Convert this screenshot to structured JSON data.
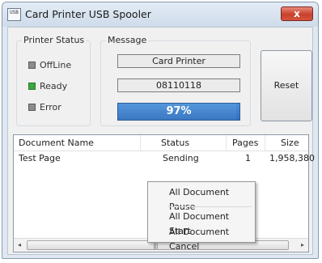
{
  "window": {
    "title": "Card Printer USB Spooler",
    "icon_text": "USB",
    "close_symbol": "x"
  },
  "printer_status": {
    "legend": "Printer Status",
    "items": [
      {
        "label": "OffLine",
        "color": "#8c8c8c"
      },
      {
        "label": "Ready",
        "color": "#3aa83a"
      },
      {
        "label": "Error",
        "color": "#8c8c8c"
      }
    ]
  },
  "message": {
    "legend": "Message",
    "line1": "Card Printer",
    "line2": "08110118",
    "progress_text": "97%",
    "progress_value": 0.97
  },
  "buttons": {
    "reset": "Reset"
  },
  "document_list": {
    "columns": [
      "Document Name",
      "Status",
      "Pages",
      "Size"
    ],
    "rows": [
      {
        "name": "Test Page",
        "status": "Sending",
        "pages": "1",
        "size": "1,958,380"
      }
    ]
  },
  "context_menu": {
    "items": [
      "All Document Pause",
      "All Document Start",
      "All Document Cancel"
    ]
  },
  "scrollbar": {
    "left_arrow": "◂",
    "right_arrow": "▸",
    "grip": "||||"
  },
  "colors": {
    "progress": "#2f6fbf",
    "close_button": "#c8412d",
    "ready_led": "#3aa83a"
  }
}
